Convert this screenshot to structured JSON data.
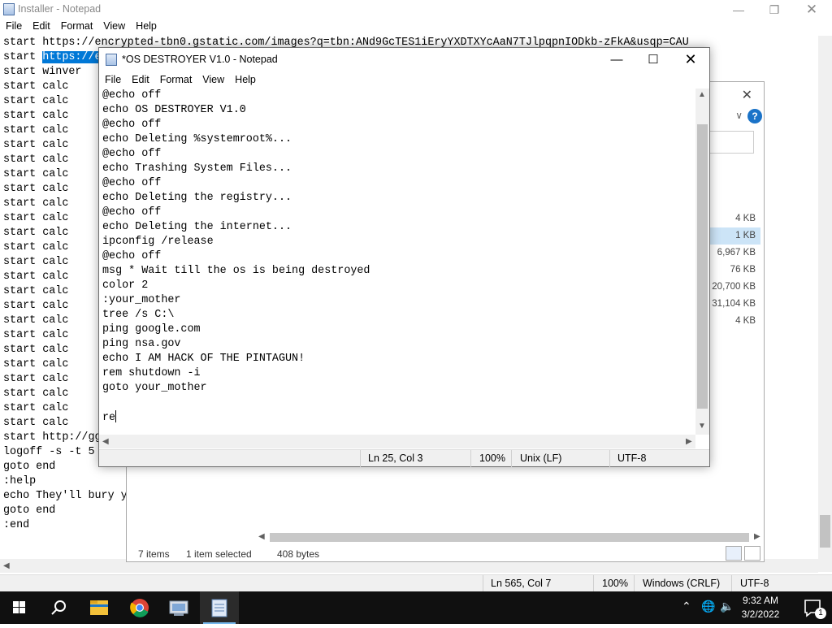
{
  "bg_notepad": {
    "title": "Installer - Notepad",
    "menu": [
      "File",
      "Edit",
      "Format",
      "View",
      "Help"
    ],
    "line1": "start https://encrypted-tbn0.gstatic.com/images?q=tbn:ANd9GcTES1iEryYXDTXYcAaN7TJlpqpnIODkb-zFkA&usqp=CAU",
    "line2_prefix": "start ",
    "line2_selected": "https://e",
    "lines": [
      "start winver",
      "start calc",
      "start calc",
      "start calc",
      "start calc",
      "start calc",
      "start calc",
      "start calc",
      "start calc",
      "start calc",
      "start calc",
      "start calc",
      "start calc",
      "start calc",
      "start calc",
      "start calc",
      "start calc",
      "start calc",
      "start calc",
      "start calc",
      "start calc",
      "start calc",
      "start calc",
      "start calc",
      "start calc",
      "start http://gg",
      "logoff -s -t 5",
      "goto end",
      ":help",
      "echo They'll bury y",
      "goto end",
      ":end"
    ],
    "status": {
      "position": "Ln 565, Col 7",
      "zoom": "100%",
      "line_ending": "Windows (CRLF)",
      "encoding": "UTF-8"
    }
  },
  "explorer": {
    "sizes": [
      "4 KB",
      "1 KB",
      "6,967 KB",
      "76 KB",
      "20,700 KB",
      "31,104 KB",
      "4 KB"
    ],
    "status": {
      "items": "7 items",
      "selected": "1 item selected",
      "size": "408 bytes"
    }
  },
  "fg_notepad": {
    "title": "*OS DESTROYER V1.0 - Notepad",
    "menu": [
      "File",
      "Edit",
      "Format",
      "View",
      "Help"
    ],
    "lines": [
      "@echo off",
      "echo OS DESTROYER V1.0",
      "@echo off",
      "echo Deleting %systemroot%...",
      "@echo off",
      "echo Trashing System Files...",
      "@echo off",
      "echo Deleting the registry...",
      "@echo off",
      "echo Deleting the internet...",
      "ipconfig /release",
      "@echo off",
      "msg * Wait till the os is being destroyed",
      "color 2",
      ":your_mother",
      "tree /s C:\\",
      "ping google.com",
      "ping nsa.gov",
      "echo I AM HACK OF THE PINTAGUN!",
      "rem shutdown -i",
      "goto your_mother",
      ""
    ],
    "current_line": "re",
    "status": {
      "position": "Ln 25, Col 3",
      "zoom": "100%",
      "line_ending": "Unix (LF)",
      "encoding": "UTF-8"
    }
  },
  "taskbar": {
    "clock_time": "9:32 AM",
    "clock_date": "3/2/2022",
    "notification_count": "1",
    "icons": [
      "start-icon",
      "search-icon",
      "file-explorer-icon",
      "chrome-icon",
      "control-panel-icon",
      "notepad-icon"
    ]
  }
}
